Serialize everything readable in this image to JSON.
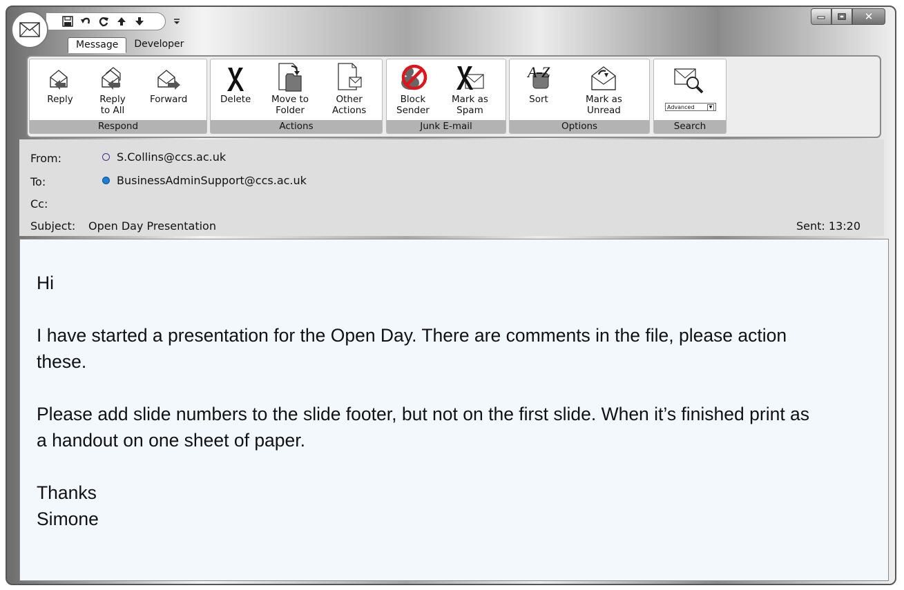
{
  "tabs": [
    {
      "label": "Message",
      "active": true
    },
    {
      "label": "Developer",
      "active": false
    }
  ],
  "ribbon": {
    "groups": [
      {
        "label": "Respond",
        "buttons": [
          {
            "label": "Reply",
            "icon": "reply-icon"
          },
          {
            "label": "Reply\nto All",
            "icon": "reply-all-icon"
          },
          {
            "label": "Forward",
            "icon": "forward-icon"
          }
        ]
      },
      {
        "label": "Actions",
        "buttons": [
          {
            "label": "Delete",
            "icon": "delete-icon"
          },
          {
            "label": "Move to\nFolder",
            "icon": "move-to-folder-icon"
          },
          {
            "label": "Other\nActions",
            "icon": "other-actions-icon"
          }
        ]
      },
      {
        "label": "Junk E-mail",
        "buttons": [
          {
            "label": "Block\nSender",
            "icon": "block-sender-icon"
          },
          {
            "label": "Mark as\nSpam",
            "icon": "mark-spam-icon"
          }
        ]
      },
      {
        "label": "Options",
        "buttons": [
          {
            "label": "Sort",
            "icon": "sort-az-icon"
          },
          {
            "label": "Mark as\nUnread",
            "icon": "mark-unread-icon"
          }
        ]
      },
      {
        "label": "Search",
        "advanced_label": "Advanced",
        "icon": "search-mail-icon"
      }
    ]
  },
  "header": {
    "from_label": "From:",
    "from_value": "S.Collins@ccs.ac.uk",
    "to_label": "To:",
    "to_value": "BusinessAdminSupport@ccs.ac.uk",
    "cc_label": "Cc:",
    "subject_label": "Subject:",
    "subject_value": "Open Day Presentation",
    "sent_label": "Sent:",
    "sent_value": "13:20"
  },
  "body": {
    "greeting": "Hi",
    "paragraph1": "I have started a presentation for the Open Day.  There are comments in the file, please action these.",
    "paragraph2": "Please add slide numbers to the slide footer, but not on the first slide.  When it’s finished print as a handout on one sheet of paper.",
    "closing": "Thanks",
    "signature": "Simone"
  },
  "colors": {
    "from_dot": "#4a2a8a",
    "to_dot": "#1e7fd8",
    "body_bg": "#f3f8fd",
    "block_red": "#e0141b"
  }
}
